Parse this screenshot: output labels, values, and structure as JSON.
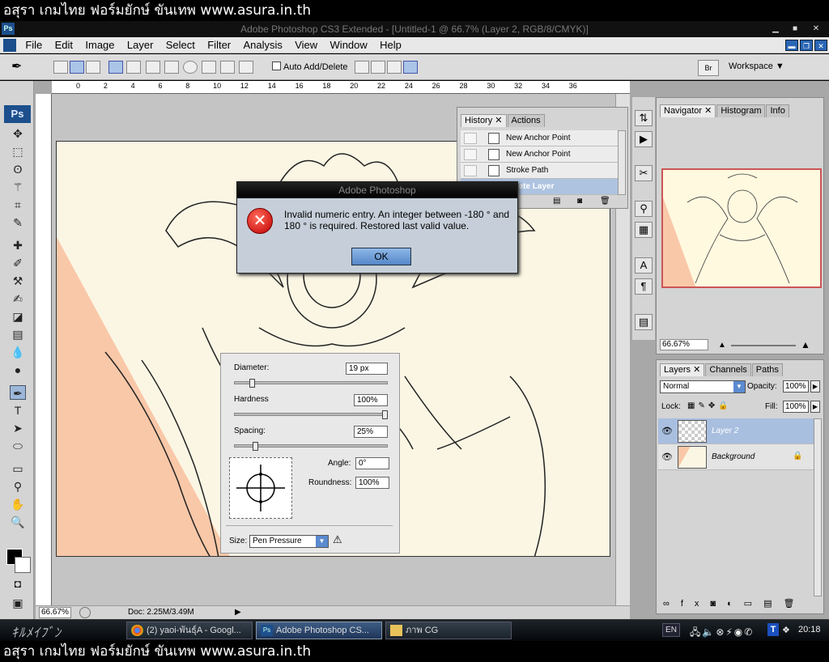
{
  "watermark": {
    "top": "อสุรา เกมไทย ฟอร์มยักษ์ ขันเทพ www.asura.in.th",
    "bottom": "อสุรา เกมไทย ฟอร์มยักษ์ ขันเทพ www.asura.in.th"
  },
  "window": {
    "title": "Adobe Photoshop CS3 Extended - [Untitled-1 @ 66.7% (Layer 2, RGB/8/CMYK)]",
    "app_icon": "Ps"
  },
  "menu": [
    "File",
    "Edit",
    "Image",
    "Layer",
    "Select",
    "Filter",
    "Analysis",
    "View",
    "Window",
    "Help"
  ],
  "options_bar": {
    "auto_add_delete": "Auto Add/Delete",
    "workspace": "Workspace ▼",
    "bridge_icon": "Br"
  },
  "toolbox": {
    "logo": "Ps"
  },
  "ruler": {
    "ticks": [
      "0",
      "2",
      "4",
      "6",
      "8",
      "10",
      "12",
      "14",
      "16",
      "18",
      "20",
      "22",
      "24",
      "26",
      "28",
      "30",
      "32",
      "34",
      "36"
    ]
  },
  "status": {
    "zoom": "66.67%",
    "doc": "Doc: 2.25M/3.49M"
  },
  "dialog": {
    "title": "Adobe Photoshop",
    "message": "Invalid numeric entry. An integer between -180 ° and 180 ° is required. Restored last valid value.",
    "ok": "OK",
    "icon": "error-icon"
  },
  "brush_panel": {
    "diameter_label": "Diameter:",
    "diameter_value": "19 px",
    "diameter_level": 0.1,
    "hardness_label": "Hardness",
    "hardness_value": "100%",
    "hardness_level": 1.0,
    "spacing_label": "Spacing:",
    "spacing_value": "25%",
    "spacing_level": 0.12,
    "angle_label": "Angle:",
    "angle_value": "0°",
    "roundness_label": "Roundness:",
    "roundness_value": "100%",
    "size_label": "Size:",
    "size_value": "Pen Pressure"
  },
  "history_panel": {
    "tabs": [
      "History",
      "Actions"
    ],
    "items": [
      "New Anchor Point",
      "New Anchor Point",
      "Stroke Path",
      "Delete Layer"
    ]
  },
  "navigator_panel": {
    "tabs": [
      "Navigator",
      "Histogram",
      "Info"
    ],
    "zoom": "66.67%"
  },
  "layers_panel": {
    "tabs": [
      "Layers",
      "Channels",
      "Paths"
    ],
    "blend_mode": "Normal",
    "opacity_label": "Opacity:",
    "opacity": "100%",
    "lock_label": "Lock:",
    "fill_label": "Fill:",
    "fill": "100%",
    "layers": [
      {
        "name": "Layer 2",
        "selected": true
      },
      {
        "name": "Background",
        "selected": false,
        "locked": true
      }
    ]
  },
  "taskbar": {
    "start_text": "ｷﾙﾒｲﾌﾞﾝ",
    "tasks": [
      {
        "label": "(2) yaoi-พันธุ์A - Googl...",
        "icon": "chrome-icon"
      },
      {
        "label": "Adobe Photoshop CS...",
        "icon": "photoshop-icon",
        "active": true
      },
      {
        "label": "ภาพ CG",
        "icon": "folder-icon"
      }
    ],
    "lang": "EN",
    "clock": "20:18"
  },
  "colors": {
    "canvas": "#fbf6e4",
    "accent_peach": "#f9c8a8",
    "dialog_bg": "#c6cfd9",
    "selection": "#a9bfe0"
  }
}
